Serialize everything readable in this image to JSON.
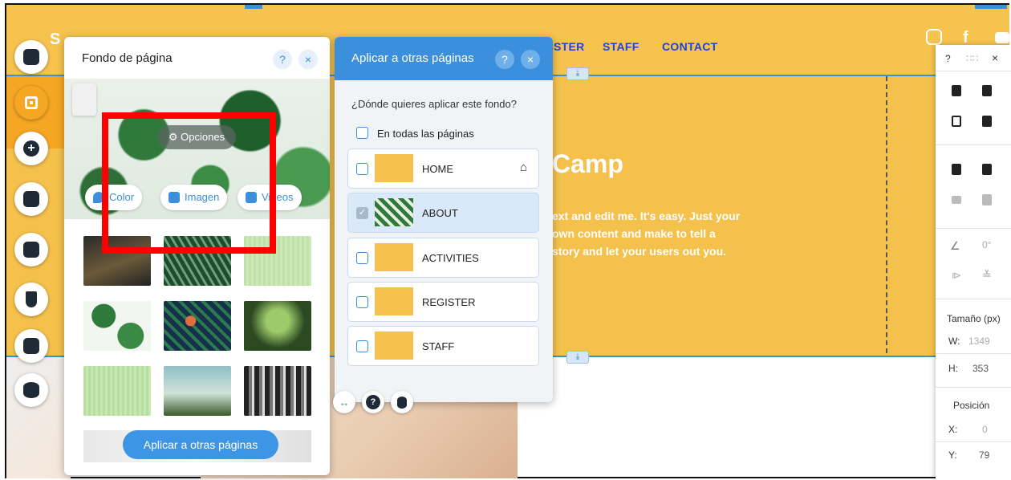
{
  "site": {
    "nav": [
      "STER",
      "STAFF",
      "CONTACT"
    ],
    "hero_title": "Camp",
    "hero_text": "ext and edit me. It's easy. Just your own content and make to tell a story and let your users out you.",
    "logo_fragment": "S",
    "anchor_glyph": "⤓"
  },
  "bg_panel": {
    "title": "Fondo de página",
    "help": "?",
    "close": "×",
    "options_label": "Opciones",
    "tabs": [
      "Color",
      "Imagen",
      "Videos"
    ],
    "apply_button": "Aplicar a otras páginas"
  },
  "apply_panel": {
    "title": "Aplicar a otras páginas",
    "help": "?",
    "close": "×",
    "question": "¿Dónde quieres aplicar este fondo?",
    "all_pages": "En todas las páginas",
    "pages": [
      {
        "name": "HOME",
        "checked": false,
        "home": true
      },
      {
        "name": "ABOUT",
        "checked": true,
        "home": false
      },
      {
        "name": "ACTIVITIES",
        "checked": false,
        "home": false
      },
      {
        "name": "REGISTER",
        "checked": false,
        "home": false
      },
      {
        "name": "STAFF",
        "checked": false,
        "home": false
      }
    ],
    "home_glyph": "⌂",
    "stretch_glyph": "↔",
    "help_glyph": "?"
  },
  "inspector": {
    "help": "?",
    "drag": "∷∷",
    "close": "×",
    "size_label": "Tamaño (px)",
    "w_label": "W:",
    "w_value": "1349",
    "h_label": "H:",
    "h_value": "353",
    "position_label": "Posición",
    "x_label": "X:",
    "x_value": "0",
    "y_label": "Y:",
    "y_value": "79",
    "rotation": "0°"
  },
  "colors": {
    "accent": "#3b8fdc",
    "site_yellow": "#f5c14d",
    "active_tool": "#f5a623",
    "nav_blue": "#1e43d8"
  }
}
